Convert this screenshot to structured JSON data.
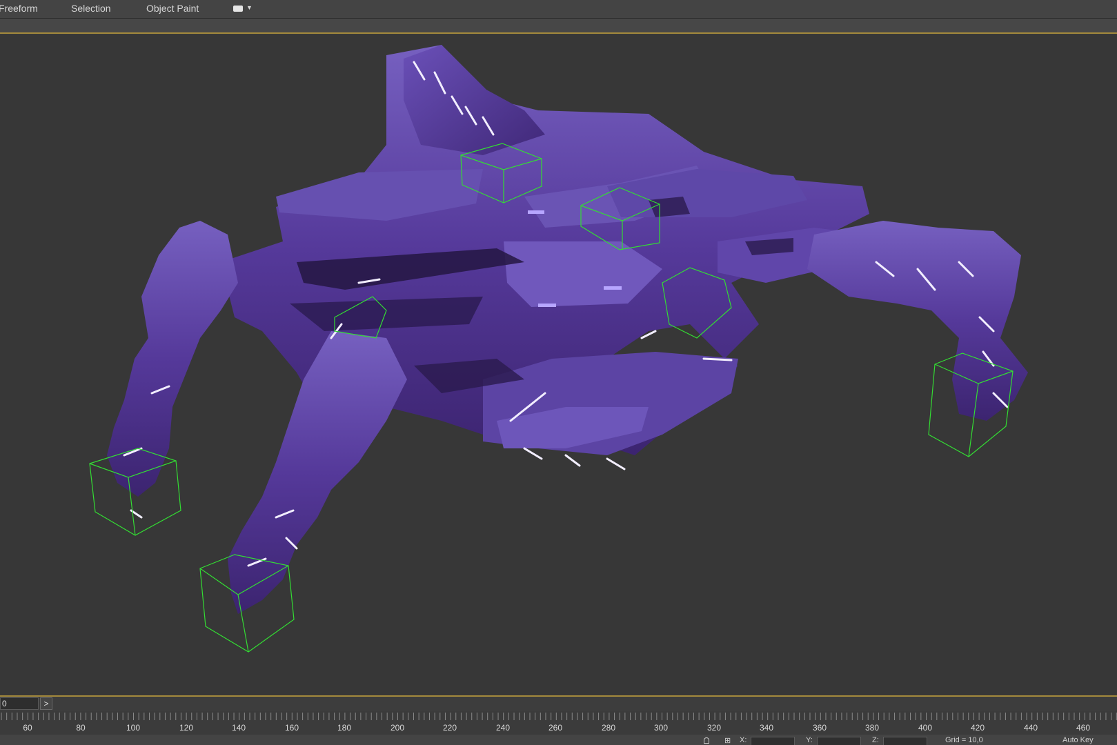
{
  "ribbon": {
    "tabs": [
      "Freeform",
      "Selection",
      "Object Paint"
    ],
    "dropdown_icon": "display-toggle-icon"
  },
  "viewport": {
    "background": "#373737",
    "mesh_color": "#5a3e9e",
    "helper_color": "#33dd33",
    "helpers": [
      "bounding-box",
      "bounding-box",
      "bounding-box",
      "bounding-box",
      "bounding-box",
      "bounding-box",
      "bounding-box"
    ]
  },
  "timeslider": {
    "frame": "0",
    "next_label": ">"
  },
  "trackbar": {
    "tick_labels": [
      "60",
      "80",
      "100",
      "120",
      "140",
      "160",
      "180",
      "200",
      "220",
      "240",
      "260",
      "280",
      "300",
      "320",
      "340",
      "360",
      "380",
      "400",
      "420",
      "440",
      "460"
    ]
  },
  "status": {
    "x_label": "X:",
    "y_label": "Y:",
    "z_label": "Z:",
    "grid": "Grid = 10,0",
    "auto_key": "Auto Key"
  }
}
